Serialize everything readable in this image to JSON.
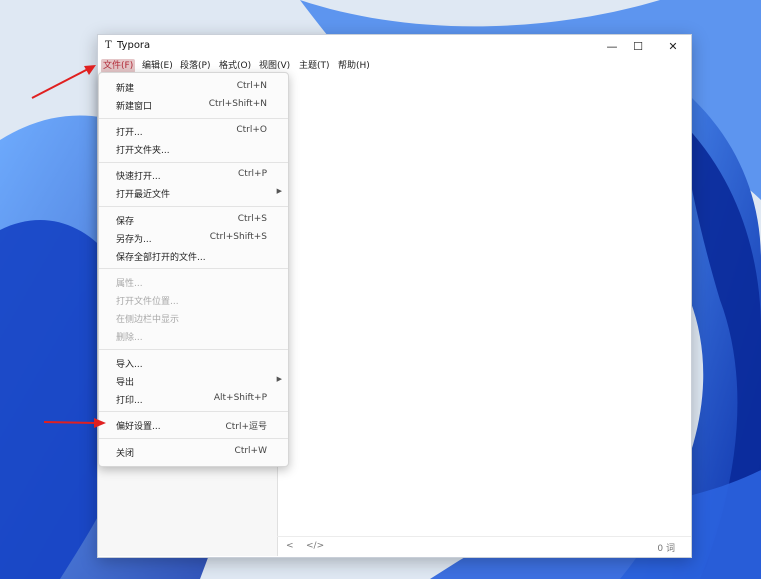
{
  "window": {
    "app_icon": "T",
    "title": "Typora",
    "minimize_glyph": "—",
    "maximize_glyph": "☐",
    "close_glyph": "✕"
  },
  "menubar": [
    {
      "label": "文件(F)",
      "active": true
    },
    {
      "label": "编辑(E)"
    },
    {
      "label": "段落(P)"
    },
    {
      "label": "格式(O)"
    },
    {
      "label": "视图(V)"
    },
    {
      "label": "主题(T)"
    },
    {
      "label": "帮助(H)"
    }
  ],
  "file_menu": {
    "items": [
      {
        "label": "新建",
        "shortcut": "Ctrl+N"
      },
      {
        "label": "新建窗口",
        "shortcut": "Ctrl+Shift+N"
      },
      {
        "label": "打开...",
        "shortcut": "Ctrl+O"
      },
      {
        "label": "打开文件夹..."
      },
      {
        "label": "快速打开...",
        "shortcut": "Ctrl+P"
      },
      {
        "label": "打开最近文件",
        "submenu": true
      },
      {
        "label": "保存",
        "shortcut": "Ctrl+S"
      },
      {
        "label": "另存为...",
        "shortcut": "Ctrl+Shift+S"
      },
      {
        "label": "保存全部打开的文件..."
      },
      {
        "label": "属性...",
        "disabled": true
      },
      {
        "label": "打开文件位置...",
        "disabled": true
      },
      {
        "label": "在侧边栏中显示",
        "disabled": true
      },
      {
        "label": "删除...",
        "disabled": true
      },
      {
        "label": "导入..."
      },
      {
        "label": "导出",
        "submenu": true
      },
      {
        "label": "打印...",
        "shortcut": "Alt+Shift+P"
      },
      {
        "label": "偏好设置...",
        "shortcut": "Ctrl+逗号"
      },
      {
        "label": "关闭",
        "shortcut": "Ctrl+W"
      }
    ],
    "submenu_glyph": "▶"
  },
  "footer": {
    "back_glyph": "<",
    "source_glyph": "</>",
    "word_count": "0 词"
  },
  "colors": {
    "active_menu_bg": "#e5c6c8",
    "annotation_arrow": "#e02020"
  }
}
